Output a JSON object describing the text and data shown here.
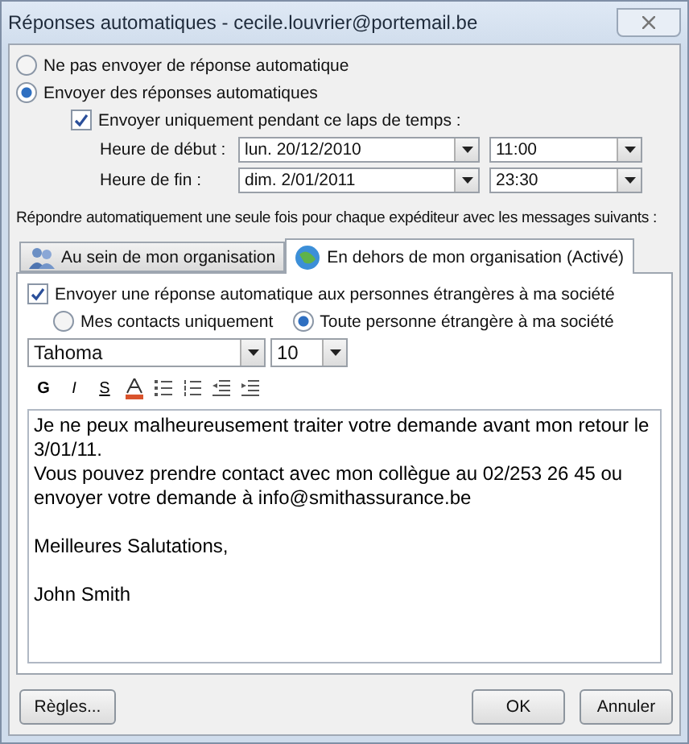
{
  "window": {
    "title": "Réponses automatiques - cecile.louvrier@portemail.be"
  },
  "mode_options": [
    {
      "label": "Ne pas envoyer de réponse automatique",
      "selected": false
    },
    {
      "label": "Envoyer des réponses automatiques",
      "selected": true
    }
  ],
  "time_range": {
    "label": "Envoyer uniquement pendant ce laps de temps :",
    "checked": true,
    "rows": [
      {
        "label": "Heure de début :",
        "date": "lun. 20/12/2010",
        "time": "11:00"
      },
      {
        "label": "Heure de fin :",
        "date": "dim. 2/01/2011",
        "time": "23:30"
      }
    ]
  },
  "instruction": "Répondre automatiquement une seule fois pour chaque expéditeur avec les messages suivants :",
  "tabs": [
    {
      "label": "Au sein de mon organisation",
      "selected": false
    },
    {
      "label": "En dehors de mon organisation (Activé)",
      "selected": true
    }
  ],
  "external": {
    "label": "Envoyer une réponse automatique aux personnes étrangères à ma société",
    "checked": true,
    "audience": [
      {
        "label": "Mes contacts uniquement",
        "selected": false
      },
      {
        "label": "Toute personne étrangère à ma société",
        "selected": true
      }
    ]
  },
  "font": {
    "family": "Tahoma",
    "size": "10"
  },
  "format_buttons": [
    {
      "kind": "text",
      "label": "G"
    },
    {
      "kind": "text",
      "label": "I"
    },
    {
      "kind": "text",
      "label": "S"
    },
    {
      "kind": "color"
    },
    {
      "kind": "bullets"
    },
    {
      "kind": "numbers"
    },
    {
      "kind": "outdent"
    },
    {
      "kind": "indent"
    }
  ],
  "message": [
    [
      "Je ne peux malheureusement traiter votre demande avant mon retour le 3/01/11.",
      "Vous pouvez prendre contact avec mon collègue au 02/253 26 45 ou envoyer votre demande à info@smithassurance.be"
    ],
    [
      "Meilleures Salutations,"
    ],
    [
      "John Smith"
    ]
  ],
  "buttons": {
    "rules": "Règles...",
    "ok": "OK",
    "cancel": "Annuler"
  }
}
